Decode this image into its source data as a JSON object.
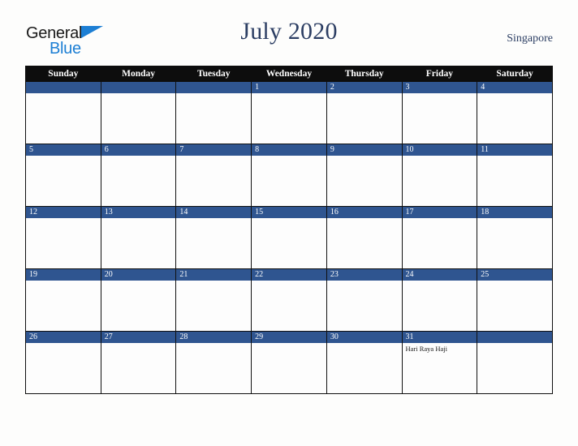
{
  "brand": {
    "name_top": "General",
    "name_bottom": "Blue",
    "accent_color": "#1d7fd4",
    "triangle_icon": "triangle-icon"
  },
  "header": {
    "title": "July 2020",
    "region": "Singapore",
    "title_color": "#2c3e63"
  },
  "calendar": {
    "header_bg": "#0d0d0d",
    "daybar_bg": "#2f5590",
    "weekday_headers": [
      "Sunday",
      "Monday",
      "Tuesday",
      "Wednesday",
      "Thursday",
      "Friday",
      "Saturday"
    ],
    "weeks": [
      [
        {
          "date": "",
          "events": []
        },
        {
          "date": "",
          "events": []
        },
        {
          "date": "",
          "events": []
        },
        {
          "date": "1",
          "events": []
        },
        {
          "date": "2",
          "events": []
        },
        {
          "date": "3",
          "events": []
        },
        {
          "date": "4",
          "events": []
        }
      ],
      [
        {
          "date": "5",
          "events": []
        },
        {
          "date": "6",
          "events": []
        },
        {
          "date": "7",
          "events": []
        },
        {
          "date": "8",
          "events": []
        },
        {
          "date": "9",
          "events": []
        },
        {
          "date": "10",
          "events": []
        },
        {
          "date": "11",
          "events": []
        }
      ],
      [
        {
          "date": "12",
          "events": []
        },
        {
          "date": "13",
          "events": []
        },
        {
          "date": "14",
          "events": []
        },
        {
          "date": "15",
          "events": []
        },
        {
          "date": "16",
          "events": []
        },
        {
          "date": "17",
          "events": []
        },
        {
          "date": "18",
          "events": []
        }
      ],
      [
        {
          "date": "19",
          "events": []
        },
        {
          "date": "20",
          "events": []
        },
        {
          "date": "21",
          "events": []
        },
        {
          "date": "22",
          "events": []
        },
        {
          "date": "23",
          "events": []
        },
        {
          "date": "24",
          "events": []
        },
        {
          "date": "25",
          "events": []
        }
      ],
      [
        {
          "date": "26",
          "events": []
        },
        {
          "date": "27",
          "events": []
        },
        {
          "date": "28",
          "events": []
        },
        {
          "date": "29",
          "events": []
        },
        {
          "date": "30",
          "events": []
        },
        {
          "date": "31",
          "events": [
            "Hari Raya Haji"
          ]
        },
        {
          "date": "",
          "events": []
        }
      ]
    ]
  }
}
